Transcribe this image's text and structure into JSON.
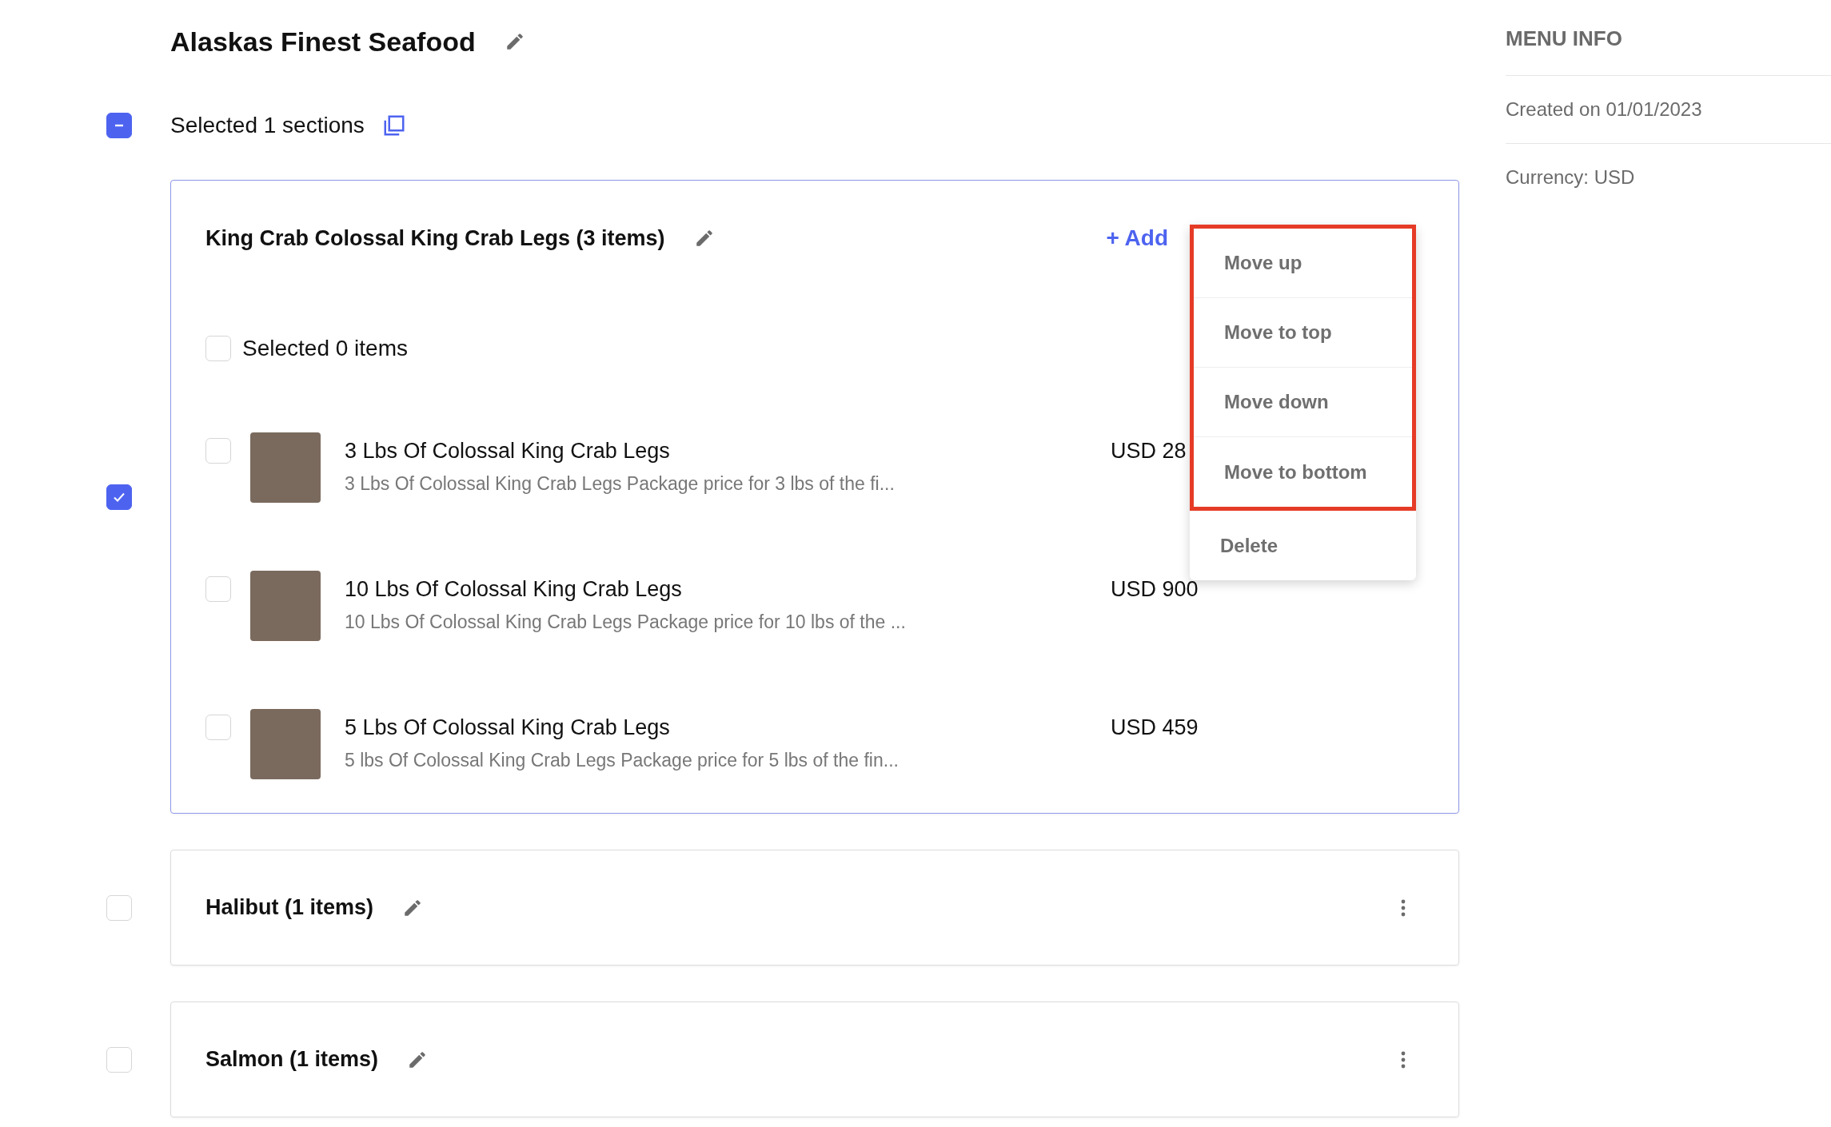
{
  "menu": {
    "title": "Alaskas Finest Seafood",
    "selection_label": "Selected 1 sections",
    "checked": false,
    "indeterminate": true
  },
  "sections": [
    {
      "title": "King Crab Colossal King Crab Legs (3 items)",
      "checked": true,
      "expanded": true,
      "add_label": "+ Add",
      "selection_label": "Selected 0 items",
      "items_checked": false,
      "items": [
        {
          "name": "3 Lbs Of Colossal King Crab Legs",
          "description": "3 Lbs Of Colossal King Crab Legs Package price for 3 lbs of the fi...",
          "price": "USD 28",
          "checked": false
        },
        {
          "name": "10 Lbs Of Colossal King Crab Legs",
          "description": "10 Lbs Of Colossal King Crab Legs Package price for 10 lbs of the ...",
          "price": "USD 900",
          "checked": false
        },
        {
          "name": "5 Lbs Of Colossal King Crab Legs",
          "description": "5 lbs Of Colossal King Crab Legs Package price for 5 lbs of the fin...",
          "price": "USD 459",
          "checked": false
        }
      ],
      "context_menu": [
        {
          "label": "Move up",
          "highlighted": true
        },
        {
          "label": "Move to top",
          "highlighted": true
        },
        {
          "label": "Move down",
          "highlighted": true
        },
        {
          "label": "Move to bottom",
          "highlighted": true
        },
        {
          "label": "Delete",
          "highlighted": false
        }
      ]
    },
    {
      "title": "Halibut (1 items)",
      "checked": false,
      "expanded": false
    },
    {
      "title": "Salmon (1 items)",
      "checked": false,
      "expanded": false
    }
  ],
  "menu_info": {
    "title": "MENU INFO",
    "rows": [
      "Created on 01/01/2023",
      "Currency: USD"
    ]
  }
}
